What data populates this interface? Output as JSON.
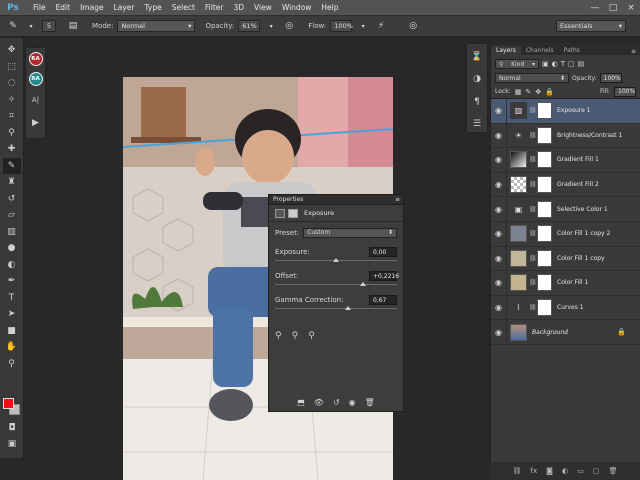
{
  "app": {
    "logo": "Ps",
    "menu": [
      "File",
      "Edit",
      "Image",
      "Layer",
      "Type",
      "Select",
      "Filter",
      "3D",
      "View",
      "Window",
      "Help"
    ],
    "window_controls": [
      "—",
      "□",
      "×"
    ]
  },
  "options_bar": {
    "brush_size": "5",
    "mode_label": "Mode:",
    "mode_value": "Normal",
    "opacity_label": "Opacity:",
    "opacity_value": "61%",
    "flow_label": "Flow:",
    "flow_value": "100%",
    "workspace": "Essentials"
  },
  "toolbar": {
    "tools": [
      "move",
      "marquee",
      "lasso",
      "quick-select",
      "crop",
      "eyedropper",
      "healing",
      "brush",
      "stamp",
      "history-brush",
      "eraser",
      "gradient",
      "blur",
      "dodge",
      "pen",
      "type",
      "path-select",
      "shape",
      "hand",
      "zoom"
    ],
    "active_tool": "brush",
    "foreground_color": "#e31414",
    "background_color": "#bfbfbf"
  },
  "mini_panel": {
    "badge1": "RA",
    "badge2": "RA",
    "type_label": "A|"
  },
  "properties": {
    "panel_title": "Properties",
    "adjustment_name": "Exposure",
    "preset_label": "Preset:",
    "preset_value": "Custom",
    "exposure_label": "Exposure:",
    "exposure_value": "0,00",
    "exposure_level": 0.5,
    "offset_label": "Offset:",
    "offset_value": "+0,2216",
    "offset_level": 0.72,
    "gamma_label": "Gamma Correction:",
    "gamma_value": "0,67",
    "gamma_level": 0.6
  },
  "layers_panel": {
    "tabs": [
      "Layers",
      "Channels",
      "Paths"
    ],
    "active_tab": "Layers",
    "filter_label": "Kind",
    "blend_mode": "Normal",
    "opacity_label": "Opacity:",
    "opacity_value": "100%",
    "lock_label": "Lock:",
    "fill_label": "Fill:",
    "fill_value": "100%",
    "layers": [
      {
        "name": "Exposure 1",
        "selected": true,
        "thumb": "adj-exposure"
      },
      {
        "name": "Brightness/Contrast 1",
        "selected": false,
        "thumb": "adj-brightness"
      },
      {
        "name": "Gradient Fill 1",
        "selected": false,
        "thumb": "gradient"
      },
      {
        "name": "Gradient Fill 2",
        "selected": false,
        "thumb": "checker"
      },
      {
        "name": "Selective Color 1",
        "selected": false,
        "thumb": "adj-selective"
      },
      {
        "name": "Color Fill 1 copy 2",
        "selected": false,
        "thumb": "#7b8290"
      },
      {
        "name": "Color Fill 1 copy",
        "selected": false,
        "thumb": "#c2b79a"
      },
      {
        "name": "Color Fill 1",
        "selected": false,
        "thumb": "#c3b490"
      },
      {
        "name": "Curves 1",
        "selected": false,
        "thumb": "adj-curves"
      },
      {
        "name": "Background",
        "selected": false,
        "thumb": "photo"
      }
    ]
  }
}
